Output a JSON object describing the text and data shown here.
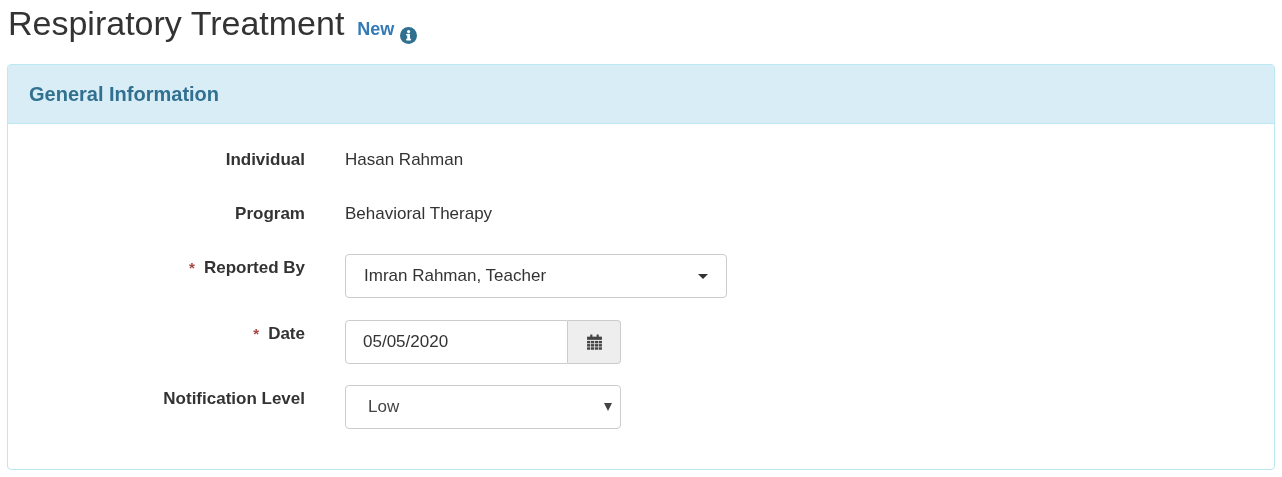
{
  "page": {
    "title": "Respiratory Treatment",
    "status": "New"
  },
  "panel": {
    "heading": "General Information",
    "fields": [
      {
        "kind": "static",
        "label": "Individual",
        "value": "Hasan Rahman"
      },
      {
        "kind": "static",
        "label": "Program",
        "value": "Behavioral Therapy"
      },
      {
        "kind": "dropdown",
        "label": "Reported By",
        "required_mark": "*",
        "value": "Imran Rahman, Teacher"
      },
      {
        "kind": "date",
        "label": "Date",
        "required_mark": "*",
        "value": "05/05/2020"
      },
      {
        "kind": "select",
        "label": "Notification Level",
        "value": "Low"
      }
    ]
  }
}
